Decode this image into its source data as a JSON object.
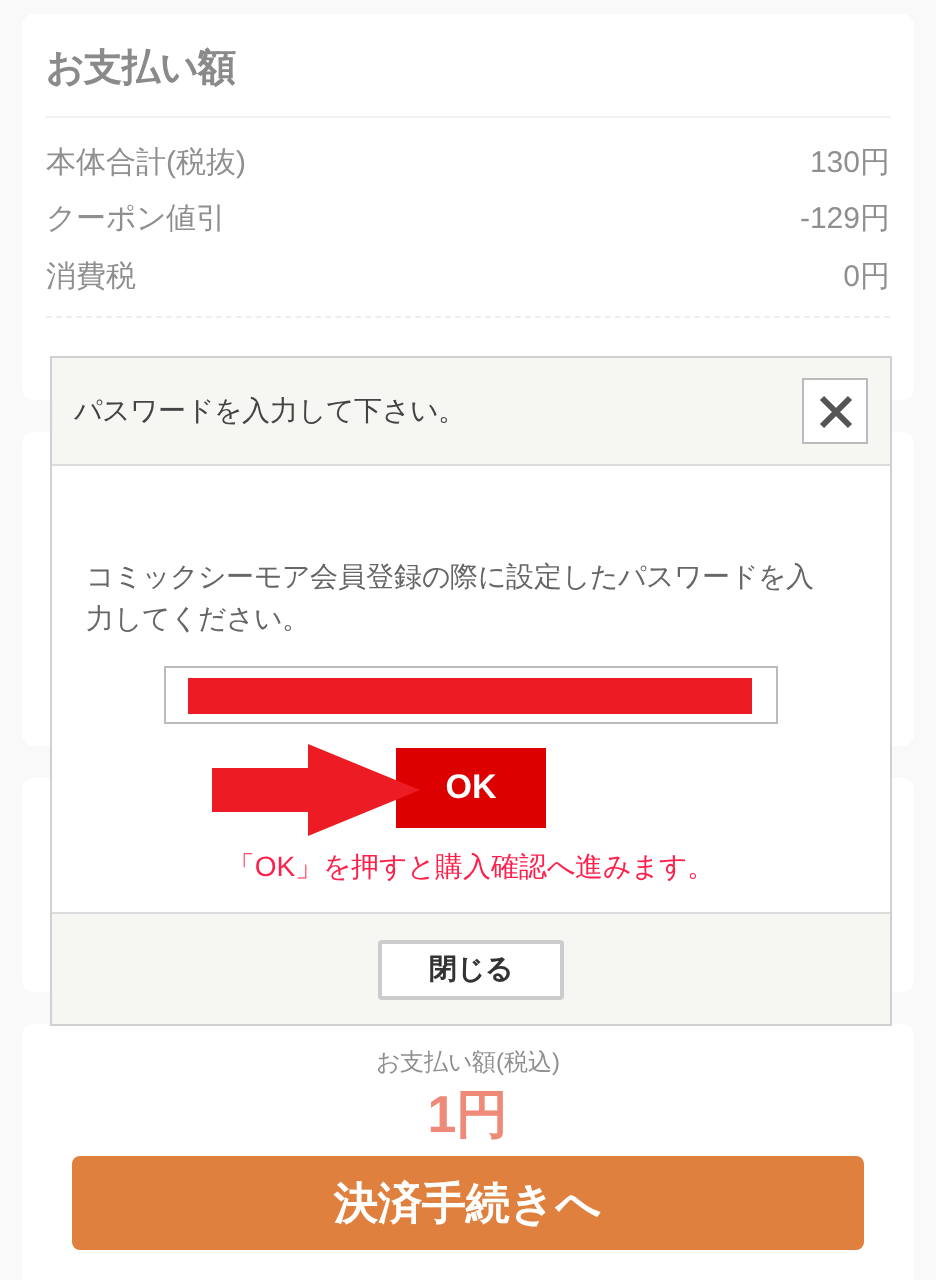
{
  "summary": {
    "title": "お支払い額",
    "rows": [
      {
        "label": "本体合計(税抜)",
        "value": "130円"
      },
      {
        "label": "クーポン値引",
        "value": "-129円"
      },
      {
        "label": "消費税",
        "value": "0円"
      }
    ]
  },
  "checkout": {
    "label": "お支払い額(税込)",
    "amount": "1円",
    "button": "決済手続きへ"
  },
  "dialog": {
    "title": "パスワードを入力して下さい。",
    "message": "コミックシーモア会員登録の際に設定したパスワードを入力してください。",
    "ok": "OK",
    "note": "「OK」を押すと購入確認へ進みます。",
    "close": "閉じる"
  }
}
